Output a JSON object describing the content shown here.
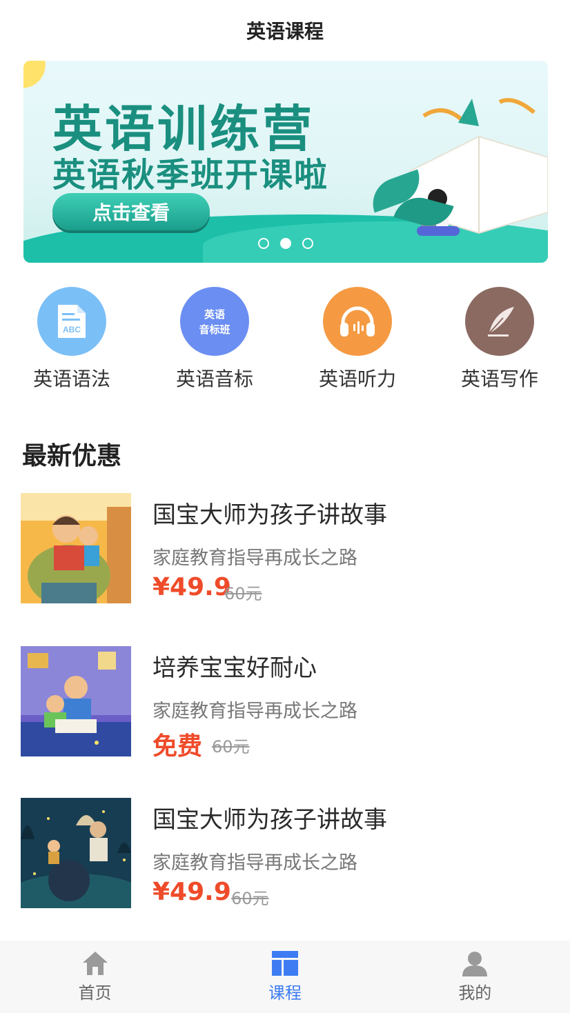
{
  "header": {
    "title": "英语课程"
  },
  "banner": {
    "title": "英语训练营",
    "subtitle": "英语秋季班开课啦",
    "cta": "点击查看",
    "dots": 3,
    "active_dot": 1
  },
  "categories": [
    {
      "label": "英语语法",
      "icon": "abc-document-icon",
      "color": "#7bbff7"
    },
    {
      "label": "英语音标",
      "icon": "phonetics-icon",
      "icon_text": "英语\n音标班",
      "color": "#6b8ef2"
    },
    {
      "label": "英语听力",
      "icon": "headphones-icon",
      "color": "#f59a42"
    },
    {
      "label": "英语写作",
      "icon": "quill-icon",
      "color": "#8a6a61"
    }
  ],
  "section": {
    "title": "最新优惠"
  },
  "courses": [
    {
      "title": "国宝大师为孩子讲故事",
      "subtitle": "家庭教育指导再成长之路",
      "price": "¥49.9",
      "original_price": "60元"
    },
    {
      "title": "培养宝宝好耐心",
      "subtitle": "家庭教育指导再成长之路",
      "price": "免费",
      "original_price": "60元"
    },
    {
      "title": "国宝大师为孩子讲故事",
      "subtitle": "家庭教育指导再成长之路",
      "price": "¥49.9",
      "original_price": "60元"
    }
  ],
  "tabbar": {
    "items": [
      {
        "label": "首页",
        "icon": "home-icon"
      },
      {
        "label": "课程",
        "icon": "course-grid-icon"
      },
      {
        "label": "我的",
        "icon": "user-icon"
      }
    ],
    "active_index": 1,
    "accent": "#3d7cf3",
    "inactive": "#9a9a9a"
  },
  "colors": {
    "price": "#ef4b2a",
    "banner_text": "#1a8f7f"
  }
}
